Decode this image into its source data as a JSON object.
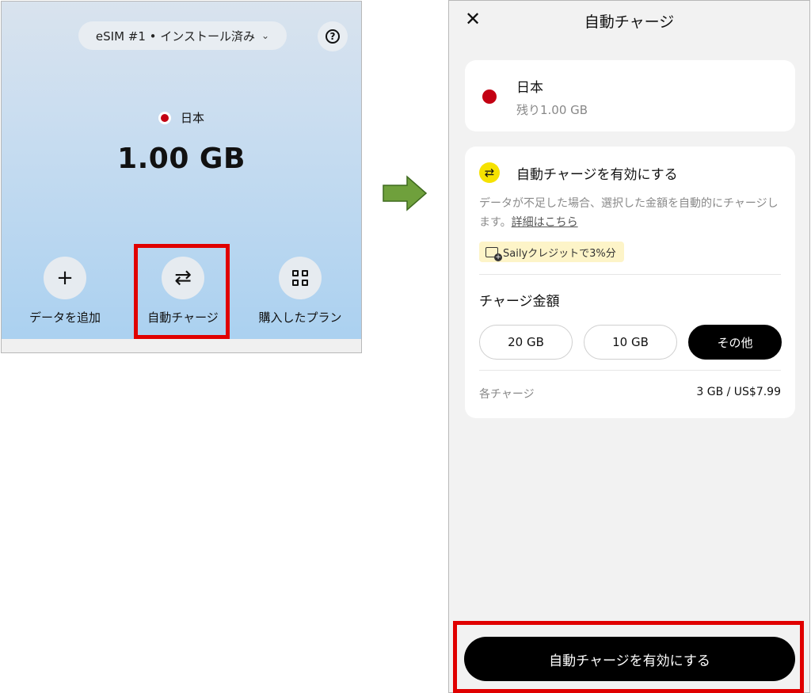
{
  "left": {
    "esim_label": "eSIM #1 • インストール済み",
    "chevron": "⌄",
    "help_symbol": "?",
    "country": "日本",
    "data_amount": "1.00 GB",
    "actions": [
      {
        "label": "データを追加",
        "icon": "plus-icon",
        "glyph": "+"
      },
      {
        "label": "自動チャージ",
        "icon": "repeat-icon",
        "glyph": "⇄"
      },
      {
        "label": "購入したプラン",
        "icon": "grid-icon"
      }
    ]
  },
  "right": {
    "close_symbol": "✕",
    "title": "自動チャージ",
    "country_card": {
      "name": "日本",
      "remaining": "残り1.00 GB"
    },
    "settings": {
      "icon_glyph": "⇄",
      "heading": "自動チャージを有効にする",
      "description": "データが不足した場合、選択した金額を自動的にチャージします。",
      "details_link": "詳細はこちら",
      "credit_badge": "Sailyクレジットで3%分",
      "amount_heading": "チャージ金額",
      "options": [
        "20 GB",
        "10 GB",
        "その他"
      ],
      "selected_option": "その他",
      "each_charge_label": "各チャージ",
      "each_charge_value": "3 GB / US$7.99"
    },
    "enable_button": "自動チャージを有効にする"
  },
  "colors": {
    "highlight": "#e00000",
    "arrow": "#6fa03c",
    "flag_red": "#c30012",
    "badge_yellow": "#f6e200"
  }
}
